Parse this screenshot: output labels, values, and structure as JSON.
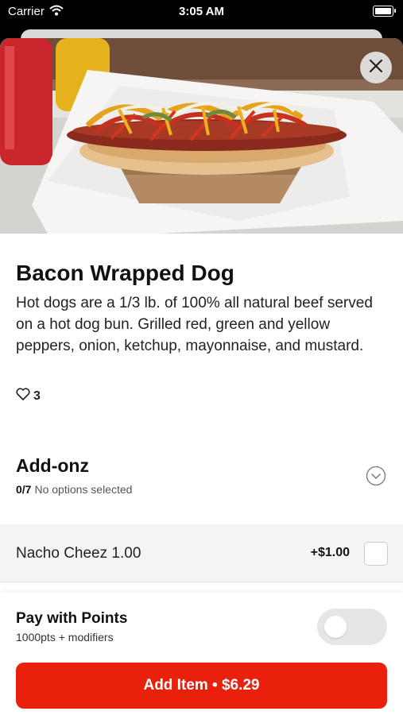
{
  "status_bar": {
    "carrier": "Carrier",
    "time": "3:05 AM"
  },
  "item": {
    "title": "Bacon Wrapped Dog",
    "description": "Hot dogs are a 1/3 lb. of 100% all natural beef served on a hot dog bun. Grilled red, green and yellow peppers, onion, ketchup, mayonnaise, and mustard.",
    "likes": "3"
  },
  "addons": {
    "title": "Add-onz",
    "selected_count": "0/7",
    "status": "No options selected",
    "options": [
      {
        "label": "Nacho Cheez 1.00",
        "price": "+$1.00",
        "checked": false
      }
    ]
  },
  "points": {
    "title": "Pay with Points",
    "subtitle": "1000pts + modifiers",
    "enabled": false
  },
  "cta": {
    "label": "Add Item • $6.29"
  },
  "colors": {
    "accent": "#e8200c",
    "toggle_off": "#e6e6e6"
  },
  "icons": [
    "wifi-icon",
    "battery-icon",
    "close-icon",
    "heart-icon",
    "chevron-down-icon"
  ]
}
